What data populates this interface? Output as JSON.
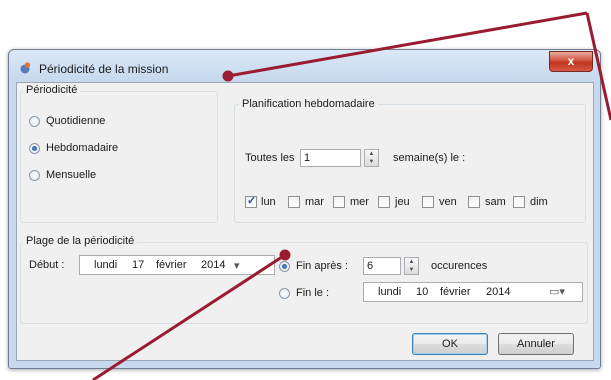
{
  "window": {
    "title": "Périodicité de la mission",
    "close_label": "x"
  },
  "periodicite": {
    "group_title": "Périodicité",
    "options": [
      "Quotidienne",
      "Hebdomadaire",
      "Mensuelle"
    ],
    "selected": "Hebdomadaire"
  },
  "planification": {
    "group_title": "Planification hebdomadaire",
    "every_label": "Toutes les",
    "every_value": "1",
    "weeks_suffix": "semaine(s) le :",
    "days": [
      {
        "label": "lun",
        "checked": true
      },
      {
        "label": "mar",
        "checked": false
      },
      {
        "label": "mer",
        "checked": false
      },
      {
        "label": "jeu",
        "checked": false
      },
      {
        "label": "ven",
        "checked": false
      },
      {
        "label": "sam",
        "checked": false
      },
      {
        "label": "dim",
        "checked": false
      }
    ]
  },
  "plage": {
    "group_title": "Plage de la périodicité",
    "debut_label": "Début :",
    "debut": {
      "weekday": "lundi",
      "day": "17",
      "month": "février",
      "year": "2014"
    },
    "fin_apres_label": "Fin après :",
    "fin_apres_value": "6",
    "occurrences_label": "occurences",
    "fin_le_label": "Fin le :",
    "fin_le": {
      "weekday": "lundi",
      "day": "10",
      "month": "février",
      "year": "2014"
    },
    "selected": "Fin après"
  },
  "buttons": {
    "ok": "OK",
    "cancel": "Annuler"
  },
  "colors": {
    "annotation": "#9b1b30",
    "title_gradient_top": "#dbe8f6",
    "close_red": "#c0331f"
  }
}
